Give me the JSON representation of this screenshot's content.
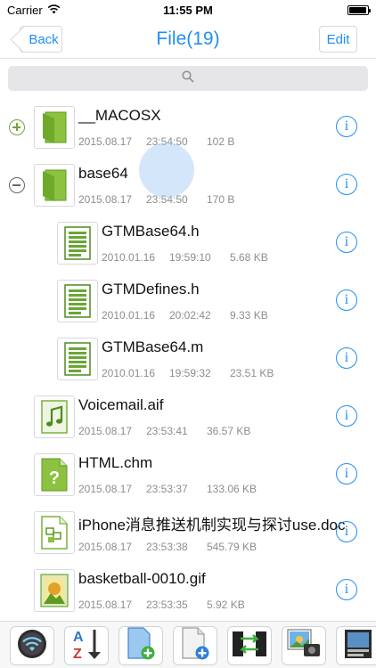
{
  "status_bar": {
    "carrier": "Carrier",
    "time": "11:55 PM",
    "battery_level": 0.95
  },
  "nav": {
    "back_label": "Back",
    "title": "File(19)",
    "edit_label": "Edit"
  },
  "search": {
    "icon": "search-icon"
  },
  "files": [
    {
      "name": "__MACOSX",
      "date": "2015.08.17",
      "time": "23:54:50",
      "size": "102 B",
      "kind": "folder",
      "expander": "plus"
    },
    {
      "name": "base64",
      "date": "2015.08.17",
      "time": "23:54:50",
      "size": "170 B",
      "kind": "folder",
      "expander": "minus"
    },
    {
      "name": "GTMBase64.h",
      "date": "2010.01.16",
      "time": "19:59:10",
      "size": "5.68 KB",
      "kind": "text",
      "nested": true
    },
    {
      "name": "GTMDefines.h",
      "date": "2010.01.16",
      "time": "20:02:42",
      "size": "9.33 KB",
      "kind": "text",
      "nested": true
    },
    {
      "name": "GTMBase64.m",
      "date": "2010.01.16",
      "time": "19:59:32",
      "size": "23.51 KB",
      "kind": "text",
      "nested": true
    },
    {
      "name": "Voicemail.aif",
      "date": "2015.08.17",
      "time": "23:53:41",
      "size": "36.57 KB",
      "kind": "audio"
    },
    {
      "name": "HTML.chm",
      "date": "2015.08.17",
      "time": "23:53:37",
      "size": "133.06 KB",
      "kind": "help"
    },
    {
      "name": "iPhone消息推送机制实现与探讨use.doc",
      "date": "2015.08.17",
      "time": "23:53:38",
      "size": "545.79 KB",
      "kind": "doc"
    },
    {
      "name": "basketball-0010.gif",
      "date": "2015.08.17",
      "time": "23:53:35",
      "size": "5.92 KB",
      "kind": "image"
    }
  ],
  "toolbar": [
    "wifi-share-icon",
    "sort-az-icon",
    "new-file-icon",
    "new-document-icon",
    "transfer-icon",
    "photo-import-icon",
    "media-icon"
  ],
  "colors": {
    "accent": "#1f8ff2",
    "folder_green": "#7ab23c",
    "meta_gray": "#8d8d8d"
  }
}
